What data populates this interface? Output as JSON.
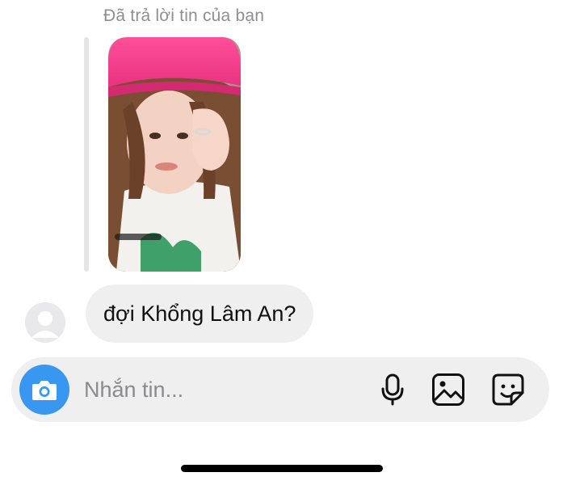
{
  "thread": {
    "reply_label": "Đã trả lời tin của bạn",
    "reply_message": "đợi Khổng Lâm An?"
  },
  "composer": {
    "placeholder": "Nhắn tin...",
    "camera_icon": "camera-icon",
    "voice_icon": "microphone-icon",
    "gallery_icon": "image-gallery-icon",
    "sticker_icon": "sticker-icon"
  },
  "colors": {
    "accent": "#3897f0",
    "bubble_bg": "#efefef",
    "composer_bg": "#efefef",
    "secondary_text": "#8e8e93"
  }
}
